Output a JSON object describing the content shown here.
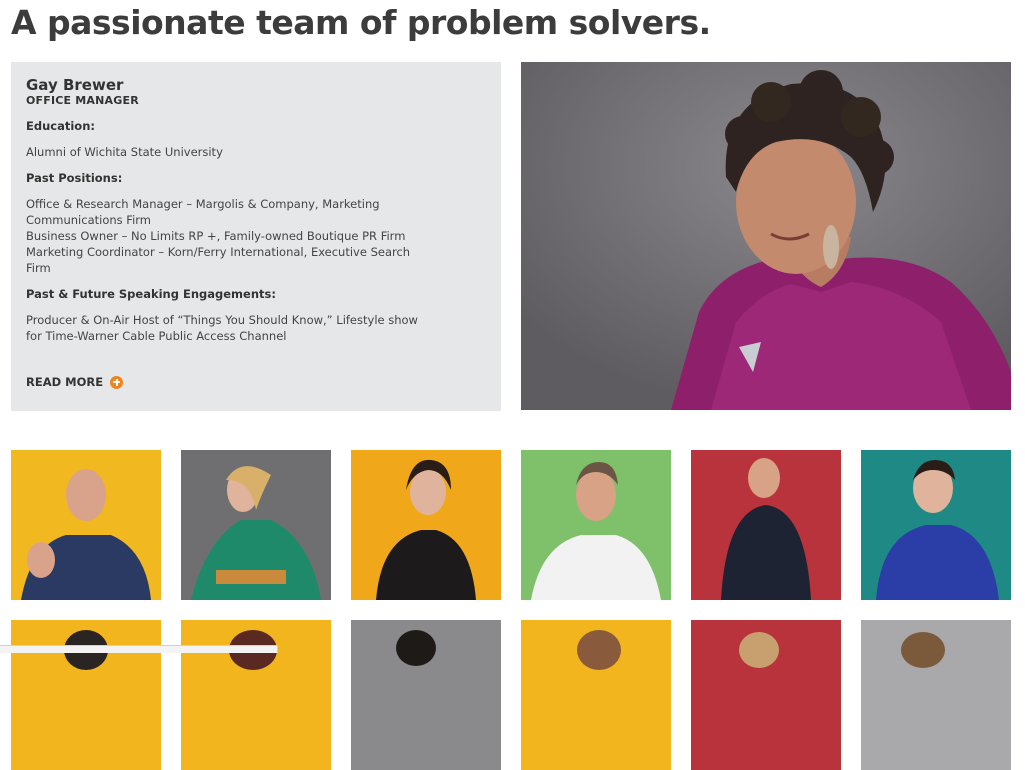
{
  "page": {
    "title": "A passionate team of problem solvers."
  },
  "bio": {
    "name": "Gay Brewer",
    "role": "OFFICE MANAGER",
    "education_heading": "Education:",
    "education": [
      "Alumni of Wichita State University"
    ],
    "past_positions_heading": "Past Positions:",
    "past_positions": [
      "Office & Research Manager – Margolis & Company, Marketing Communications Firm",
      "Business Owner – No Limits RP +, Family-owned Boutique PR Firm",
      "Marketing Coordinator – Korn/Ferry International, Executive Search Firm"
    ],
    "speaking_heading": "Past & Future Speaking Engagements:",
    "speaking": [
      "Producer & On-Air Host of “Things You Should Know,” Lifestyle show for Time-Warner Cable Public Access Channel"
    ],
    "read_more_label": "READ MORE",
    "read_more_icon": "plus-circle-icon",
    "accent_color": "#f0841f"
  },
  "team_grid": {
    "row1_backgrounds": [
      "#f1b820",
      "#6f6f71",
      "#f0a81a",
      "#7ec16a",
      "#b8333b",
      "#1f8a85"
    ],
    "row2_backgrounds": [
      "#f2b51e",
      "#f2b51e",
      "#8a8a8c",
      "#f2b51e",
      "#b8333b",
      "#a9a9ab"
    ]
  }
}
